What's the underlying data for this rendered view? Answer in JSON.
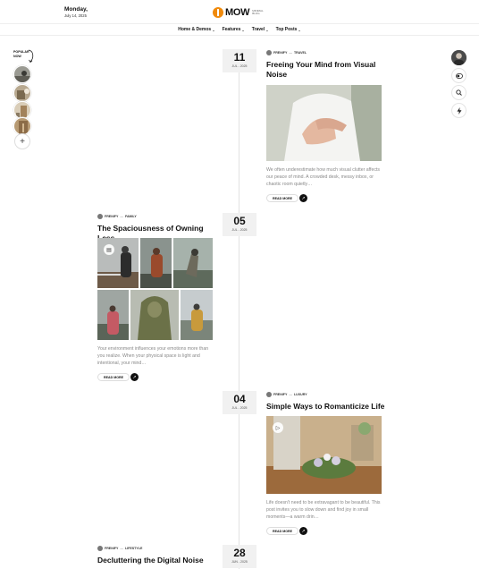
{
  "header": {
    "day": "Monday,",
    "date": "July 14, 2025",
    "logo_text": "MOW",
    "logo_tagline": "MINIMAL BLOG"
  },
  "nav": {
    "items": [
      {
        "label": "Home & Demos"
      },
      {
        "label": "Features"
      },
      {
        "label": "Travel"
      },
      {
        "label": "Top Posts"
      }
    ]
  },
  "popular": {
    "label_line1": "POPULAR",
    "label_line2": "NOW"
  },
  "posts": [
    {
      "day": "11",
      "month": "JUL - 2025",
      "author": "FRENIFY",
      "category": "TRAVEL",
      "title": "Freeing Your Mind from Visual Noise",
      "excerpt": "We often underestimate how much visual clutter affects our peace of mind. A crowded desk, messy inbox, or chaotic room quietly…",
      "read_more": "READ MORE"
    },
    {
      "day": "05",
      "month": "JUL - 2025",
      "author": "FRENIFY",
      "category": "FAMILY",
      "title": "The Spaciousness of Owning Less",
      "excerpt": "Your environment influences your emotions more than you realize. When your physical space is light and intentional, your mind…",
      "read_more": "READ MORE"
    },
    {
      "day": "04",
      "month": "JUL - 2025",
      "author": "FRENIFY",
      "category": "LUXURY",
      "title": "Simple Ways to Romanticize Life",
      "excerpt": "Life doesn't need to be extravagant to be beautiful. This post invites you to slow down and find joy in small moments—a warm drin…",
      "read_more": "READ MORE"
    },
    {
      "day": "28",
      "month": "JUN - 2025",
      "author": "FRENIFY",
      "category": "LIFESTYLE",
      "title": "Decluttering the Digital Noise"
    }
  ],
  "colors": {
    "accent": "#f08a0c",
    "timeline": "#e2e2e2",
    "datebox_bg": "#f1f1f1"
  }
}
